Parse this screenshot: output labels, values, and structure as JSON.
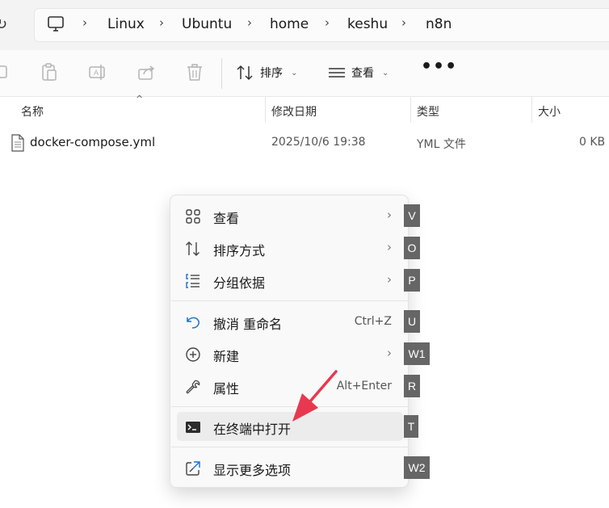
{
  "addressbar": {
    "refresh_icon": "refresh-icon",
    "pc_icon": "monitor-icon",
    "breadcrumb": [
      "Linux",
      "Ubuntu",
      "home",
      "keshu",
      "n8n"
    ]
  },
  "toolbar": {
    "sort_label": "排序",
    "view_label": "查看",
    "more_label": "•••"
  },
  "columns": {
    "name": "名称",
    "modified": "修改日期",
    "type": "类型",
    "size": "大小"
  },
  "files": [
    {
      "name": "docker-compose.yml",
      "modified": "2025/10/6 19:38",
      "type": "YML 文件",
      "size": "0 KB"
    }
  ],
  "context_menu": {
    "items": [
      {
        "label": "查看",
        "icon": "grid-icon",
        "submenu": true,
        "key": "V"
      },
      {
        "label": "排序方式",
        "icon": "sort-icon",
        "submenu": true,
        "key": "O"
      },
      {
        "label": "分组依据",
        "icon": "group-list-icon",
        "submenu": true,
        "key": "P"
      },
      {
        "label": "撤消 重命名",
        "icon": "undo-icon",
        "shortcut": "Ctrl+Z",
        "key": "U"
      },
      {
        "label": "新建",
        "icon": "plus-circle-icon",
        "submenu": true,
        "key": "W1"
      },
      {
        "label": "属性",
        "icon": "wrench-icon",
        "shortcut": "Alt+Enter",
        "key": "R"
      },
      {
        "label": "在终端中打开",
        "icon": "terminal-icon",
        "highlighted": true,
        "key": "T"
      },
      {
        "label": "显示更多选项",
        "icon": "open-external-icon",
        "key": "W2"
      }
    ],
    "submenu_glyph": "›"
  },
  "colors": {
    "annotation_arrow": "#e8384f",
    "access_key_bg": "#666666"
  }
}
